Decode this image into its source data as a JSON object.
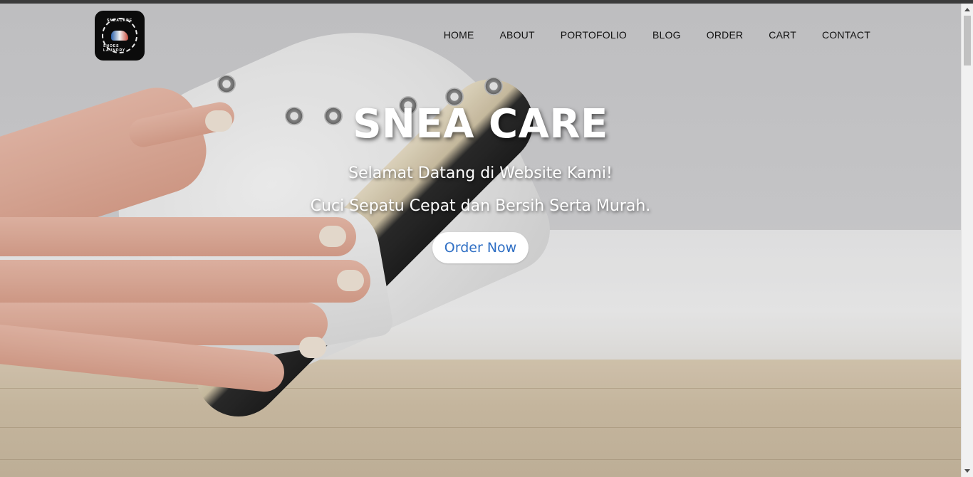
{
  "brand": {
    "logo_top_text": "SNEACARE",
    "logo_bottom_text": "SHOES LAUNDRY"
  },
  "nav": {
    "items": [
      {
        "label": "HOME"
      },
      {
        "label": "ABOUT"
      },
      {
        "label": "PORTOFOLIO"
      },
      {
        "label": "BLOG"
      },
      {
        "label": "ORDER"
      },
      {
        "label": "CART"
      },
      {
        "label": "CONTACT"
      }
    ]
  },
  "hero": {
    "title": "SNEA CARE",
    "subtitle_1": "Selamat Datang di Website Kami!",
    "subtitle_2": "Cuci Sepatu Cepat dan Bersih Serta Murah.",
    "cta_label": "Order Now"
  },
  "colors": {
    "cta_text": "#2f6fc4",
    "nav_text": "#111111",
    "hero_text": "#ffffff"
  }
}
